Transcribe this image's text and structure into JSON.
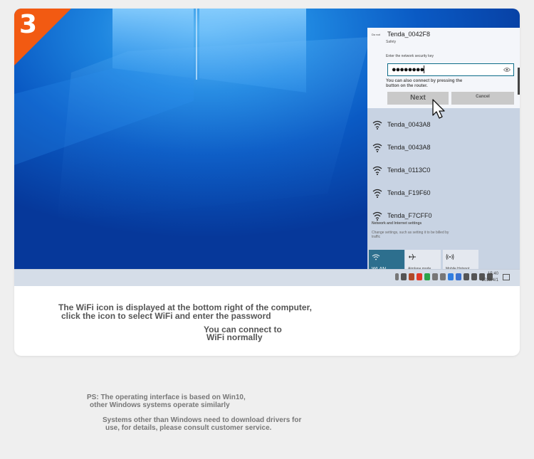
{
  "step": {
    "number": "3"
  },
  "wifi_panel": {
    "header_small": "Do not",
    "connecting_network": "Tenda_0042F8",
    "security_label": "Safety",
    "key_prompt": "Enter the network security key",
    "password_masked": "●●●●●●●●",
    "router_hint": "You can also connect by pressing the button on the router.",
    "next_label": "Next",
    "cancel_label": "Cancel",
    "networks": [
      "Tenda_0043A8",
      "Tenda_0043A8",
      "Tenda_0113C0",
      "Tenda_F19F60",
      "Tenda_F7CFF0"
    ],
    "settings_title": "Network and Internet settings",
    "settings_desc": "Change settings, such as setting it to be billed by traffic",
    "tiles": {
      "wlan": "WLAN",
      "airplane": "Airplane mode",
      "hotspot": "Mobile Hotspot"
    }
  },
  "taskbar": {
    "time": "15:40",
    "date": "2023/4/1"
  },
  "caption": {
    "line1": "The WiFi icon is displayed at the bottom right of the computer,",
    "line2": "click the icon to select WiFi and enter the password",
    "line3": "You can connect to",
    "line4": "WiFi normally"
  },
  "notes": {
    "ps_line1": "PS: The operating interface is based on Win10,",
    "ps_line2": "other Windows systems operate similarly",
    "drivers_line1": "Systems other than Windows need to download drivers for",
    "drivers_line2": "use, for details, please consult customer service."
  },
  "colors": {
    "badge": "#f25a12",
    "wlan_tile": "#2d6f8e",
    "input_border": "#0d6c88"
  }
}
